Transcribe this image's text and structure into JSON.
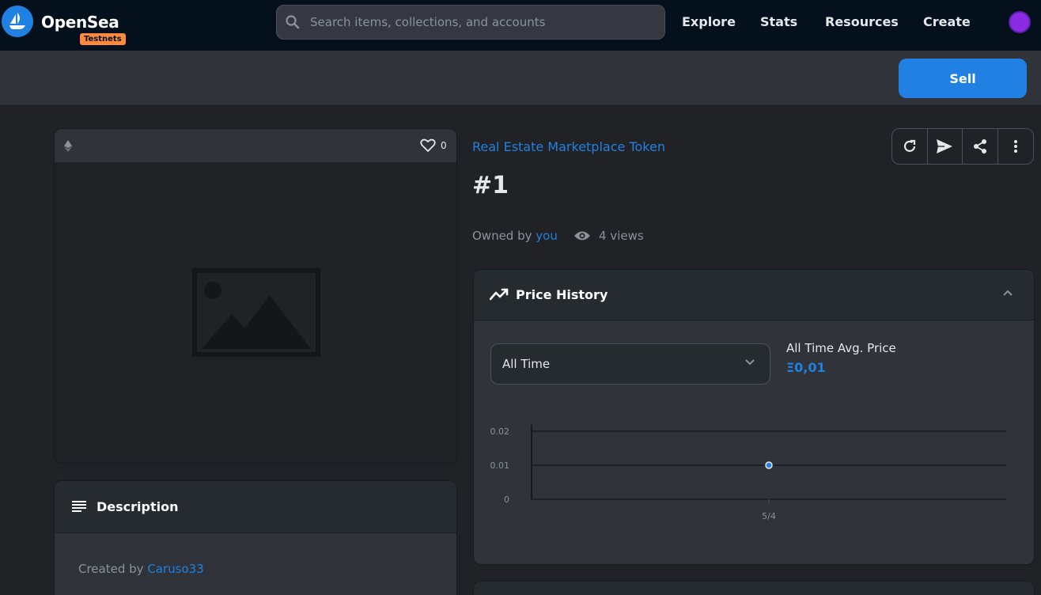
{
  "nav": {
    "brand": "OpenSea",
    "badge": "Testnets",
    "search_placeholder": "Search items, collections, and accounts",
    "links": [
      "Explore",
      "Stats",
      "Resources",
      "Create"
    ]
  },
  "sellbar": {
    "sell_label": "Sell"
  },
  "media": {
    "favorites_count": "0"
  },
  "description": {
    "title": "Description",
    "created_prefix": "Created by",
    "creator": "Caruso33"
  },
  "item": {
    "collection": "Real Estate Marketplace Token",
    "title": "#1",
    "owned_prefix": "Owned by",
    "owner": "you",
    "views": "4 views"
  },
  "price_history": {
    "title": "Price History",
    "range_selected": "All Time",
    "avg_label": "All Time Avg. Price",
    "avg_value": "Ξ0,01"
  },
  "chart_data": {
    "type": "scatter",
    "x": [
      "5/4"
    ],
    "values": [
      0.01
    ],
    "y_ticks": [
      "0",
      "0.01",
      "0.02"
    ],
    "ylim": [
      0,
      0.02
    ],
    "grid": true
  },
  "colors": {
    "accent": "#2081e2",
    "nav_bg": "#04111d",
    "badge": "#ff8a3d"
  }
}
